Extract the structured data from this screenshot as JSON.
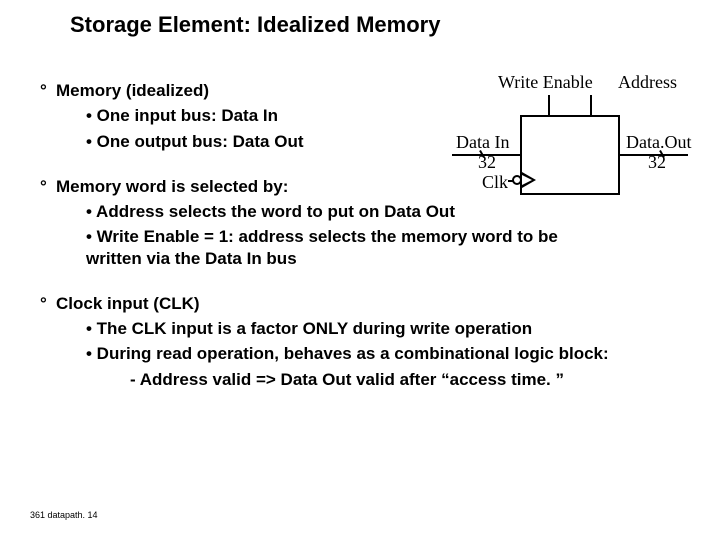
{
  "title": "Storage Element: Idealized Memory",
  "bullets": {
    "b1": "Memory (idealized)",
    "b1a": "• One input bus: Data In",
    "b1b": "• One output bus: Data Out",
    "b2": "Memory word is selected by:",
    "b2a": "• Address selects the word to put on Data Out",
    "b2b": "• Write Enable = 1: address selects the memory word to be written via the Data In bus",
    "b3": "Clock input (CLK)",
    "b3a": "• The CLK input is a factor ONLY during write operation",
    "b3b": "• During read operation, behaves  as a combinational logic block:",
    "b3c": "-   Address valid => Data Out valid after “access time. ”"
  },
  "diagram": {
    "write_enable": "Write Enable",
    "address": "Address",
    "data_in": "Data In",
    "data_in_width": "32",
    "clk": "Clk",
    "data_out": "Data.Out",
    "data_out_width": "32"
  },
  "footer": "361 datapath. 14",
  "degree": "°"
}
